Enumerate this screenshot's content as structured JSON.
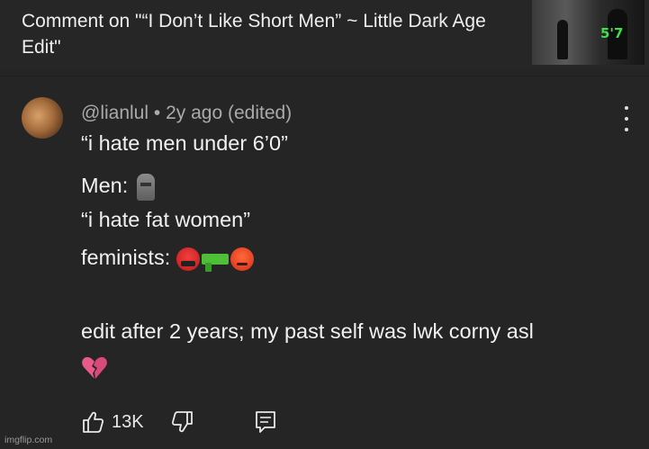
{
  "header": {
    "title": "Comment on \"“I Don’t Like Short Men” ~ Little Dark Age Edit\"",
    "thumbnail_overlay_text": "5'7"
  },
  "comment": {
    "author": "@lianlul",
    "separator": "•",
    "age": "2y ago (edited)",
    "lines": [
      "“i hate men under 6’0”",
      "Men:",
      "“i hate fat women”",
      "feminists:",
      "edit after 2 years; my past self was lwk corny asl"
    ],
    "emoji": {
      "men_reaction": "moai-icon",
      "feminists_reaction": [
        "face-with-symbols-icon",
        "water-pistol-icon",
        "pouting-face-icon"
      ],
      "edit_reaction": "broken-heart-icon"
    }
  },
  "actions": {
    "like_count": "13K"
  },
  "watermark": "imgflip.com",
  "colors": {
    "background": "#252525",
    "text": "#f1f1f1",
    "meta": "#aaaaaa",
    "accent_broken_heart": "#e85a8a"
  }
}
